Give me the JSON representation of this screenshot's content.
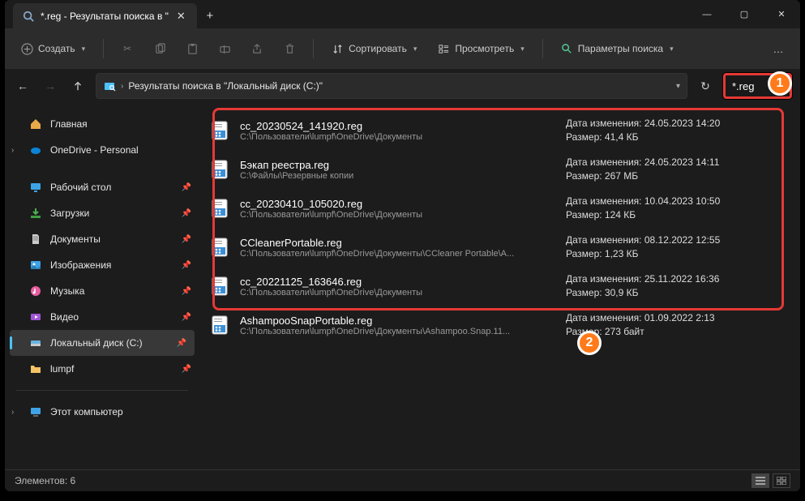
{
  "window": {
    "tab_title": "*.reg - Результаты поиска в \"",
    "minimize": "—",
    "maximize": "▢",
    "close": "✕"
  },
  "toolbar": {
    "create_label": "Создать",
    "sort_label": "Сортировать",
    "view_label": "Просмотреть",
    "search_params_label": "Параметры поиска",
    "more": "…"
  },
  "address": {
    "path_text": "Результаты поиска в \"Локальный диск (C:)\"",
    "refresh": "↻"
  },
  "search": {
    "value": "*.reg",
    "clear": "✕"
  },
  "sidebar": {
    "home": "Главная",
    "onedrive": "OneDrive - Personal",
    "desktop": "Рабочий стол",
    "downloads": "Загрузки",
    "documents": "Документы",
    "pictures": "Изображения",
    "music": "Музыка",
    "videos": "Видео",
    "local_disk": "Локальный диск (C:)",
    "lumpf": "lumpf",
    "this_pc": "Этот компьютер"
  },
  "results": [
    {
      "name": "cc_20230524_141920.reg",
      "path": "C:\\Пользователи\\lumpf\\OneDrive\\Документы",
      "modified_label": "Дата изменения:",
      "modified": "24.05.2023 14:20",
      "size_label": "Размер:",
      "size": "41,4 КБ"
    },
    {
      "name": "Бэкап реестра.reg",
      "path": "C:\\Файлы\\Резервные копии",
      "modified_label": "Дата изменения:",
      "modified": "24.05.2023 14:11",
      "size_label": "Размер:",
      "size": "267 МБ"
    },
    {
      "name": "cc_20230410_105020.reg",
      "path": "C:\\Пользователи\\lumpf\\OneDrive\\Документы",
      "modified_label": "Дата изменения:",
      "modified": "10.04.2023 10:50",
      "size_label": "Размер:",
      "size": "124 КБ"
    },
    {
      "name": "CCleanerPortable.reg",
      "path": "C:\\Пользователи\\lumpf\\OneDrive\\Документы\\CCleaner Portable\\A...",
      "modified_label": "Дата изменения:",
      "modified": "08.12.2022 12:55",
      "size_label": "Размер:",
      "size": "1,23 КБ"
    },
    {
      "name": "cc_20221125_163646.reg",
      "path": "C:\\Пользователи\\lumpf\\OneDrive\\Документы",
      "modified_label": "Дата изменения:",
      "modified": "25.11.2022 16:36",
      "size_label": "Размер:",
      "size": "30,9 КБ"
    },
    {
      "name": "AshampooSnapPortable.reg",
      "path": "C:\\Пользователи\\lumpf\\OneDrive\\Документы\\Ashampoo.Snap.11...",
      "modified_label": "Дата изменения:",
      "modified": "01.09.2022 2:13",
      "size_label": "Размер:",
      "size": "273 байт"
    }
  ],
  "footer": {
    "count_label": "Элементов: 6"
  },
  "annotations": {
    "one": "1",
    "two": "2"
  }
}
